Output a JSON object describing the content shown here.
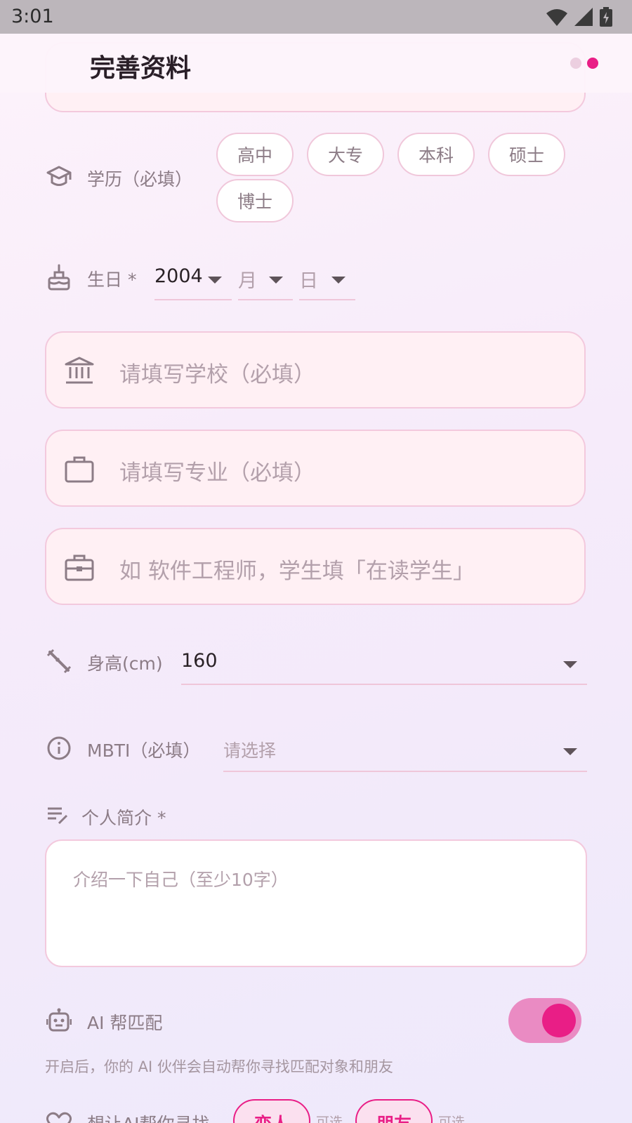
{
  "status_bar": {
    "time": "3:01"
  },
  "app_bar": {
    "title": "完善资料",
    "steps": 2,
    "current_step": 2
  },
  "education": {
    "label": "学历（必填）",
    "options": [
      "高中",
      "大专",
      "本科",
      "硕士",
      "博士"
    ]
  },
  "birthday": {
    "label": "生日 *",
    "year": "2004",
    "month_placeholder": "月",
    "day_placeholder": "日"
  },
  "school": {
    "placeholder": "请填写学校（必填）"
  },
  "major": {
    "placeholder": "请填写专业（必填）"
  },
  "job": {
    "placeholder": "如 软件工程师，学生填「在读学生」"
  },
  "height": {
    "label": "身高(cm)",
    "value": "160"
  },
  "mbti": {
    "label": "MBTI（必填）",
    "placeholder": "请选择"
  },
  "bio": {
    "label": "个人简介 *",
    "placeholder": "介绍一下自己（至少10字）"
  },
  "ai_match": {
    "label": "AI 帮匹配",
    "enabled": true,
    "hint": "开启后，你的 AI 伙伴会自动帮你寻找匹配对象和朋友"
  },
  "seek": {
    "label": "想让AI帮你寻找",
    "options": [
      {
        "label": "恋人",
        "note": "可选"
      },
      {
        "label": "朋友",
        "note": "可选"
      }
    ]
  },
  "colors": {
    "accent": "#e91e86",
    "border": "#f3c9dd",
    "field_bg": "#fff0f4"
  }
}
